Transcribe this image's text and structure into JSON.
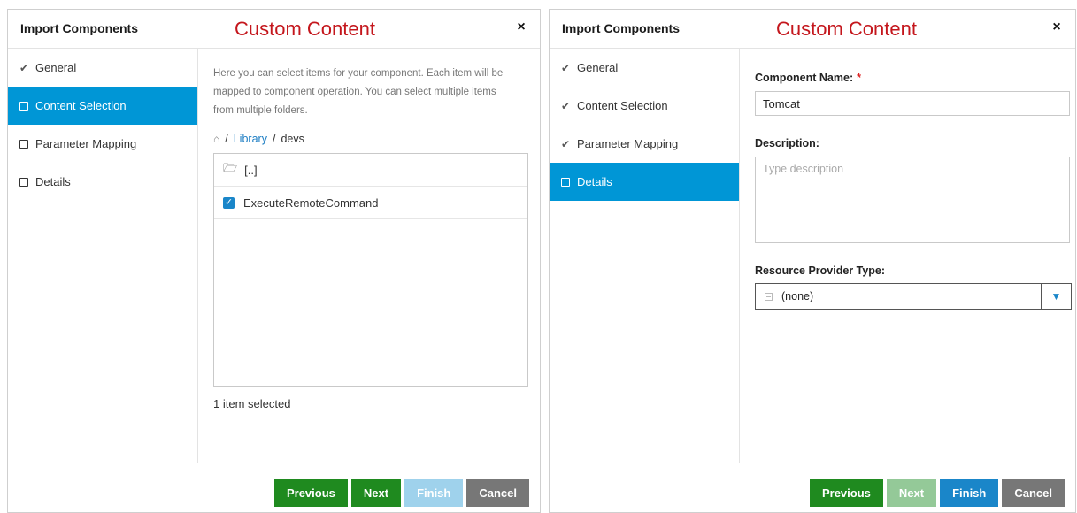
{
  "dialog1": {
    "title": "Import Components",
    "overlay": "Custom Content",
    "close_glyph": "×",
    "steps": [
      {
        "label": "General",
        "state": "done"
      },
      {
        "label": "Content Selection",
        "state": "active"
      },
      {
        "label": "Parameter Mapping",
        "state": "todo"
      },
      {
        "label": "Details",
        "state": "todo"
      }
    ],
    "intro": "Here you can select items for your component. Each item will be mapped to component operation. You can select multiple items from multiple folders.",
    "breadcrumb": {
      "link": "Library",
      "current": "devs",
      "separator": "/"
    },
    "files": [
      {
        "label": "[..]",
        "type": "parent-folder"
      },
      {
        "label": "ExecuteRemoteCommand",
        "type": "item",
        "checked": true
      }
    ],
    "selected_count": "1 item selected",
    "buttons": {
      "previous": "Previous",
      "next": "Next",
      "finish": "Finish",
      "cancel": "Cancel"
    }
  },
  "dialog2": {
    "title": "Import Components",
    "overlay": "Custom Content",
    "close_glyph": "×",
    "steps": [
      {
        "label": "General",
        "state": "done"
      },
      {
        "label": "Content Selection",
        "state": "done"
      },
      {
        "label": "Parameter Mapping",
        "state": "done"
      },
      {
        "label": "Details",
        "state": "active"
      }
    ],
    "form": {
      "name_label": "Component Name:",
      "required_mark": "*",
      "name_value": "Tomcat",
      "description_label": "Description:",
      "description_placeholder": "Type description",
      "provider_label": "Resource Provider Type:",
      "provider_value": "(none)"
    },
    "buttons": {
      "previous": "Previous",
      "next": "Next",
      "finish": "Finish",
      "cancel": "Cancel"
    }
  },
  "colors": {
    "accent": "#0096d6",
    "green": "#1f8a1f",
    "overlay": "#c4161c"
  }
}
